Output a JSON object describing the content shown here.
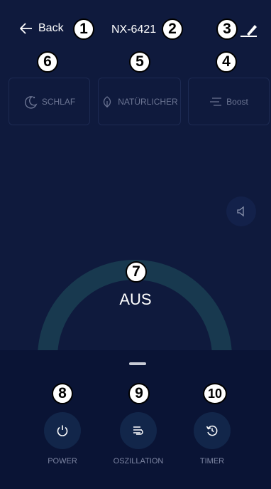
{
  "header": {
    "back_label": "Back",
    "device_name": "NX-6421"
  },
  "modes": [
    {
      "label": "SCHLAF",
      "icon": "moon-icon"
    },
    {
      "label": "NATÜRLICHER",
      "icon": "leaf-icon"
    },
    {
      "label": "Boost",
      "icon": "boost-lines-icon"
    }
  ],
  "dial": {
    "status": "AUS"
  },
  "controls": [
    {
      "label": "POWER",
      "icon": "power-icon"
    },
    {
      "label": "OSZILLATION",
      "icon": "oscillation-icon"
    },
    {
      "label": "TIMER",
      "icon": "timer-icon"
    }
  ],
  "annotations": [
    "1",
    "2",
    "3",
    "4",
    "5",
    "6",
    "7",
    "8",
    "9",
    "10"
  ],
  "colors": {
    "background": "#0f1a3d",
    "panel": "#0a1435",
    "dial_ring": "#18394f",
    "button": "#12264a",
    "muted_text": "#7e86a3"
  }
}
